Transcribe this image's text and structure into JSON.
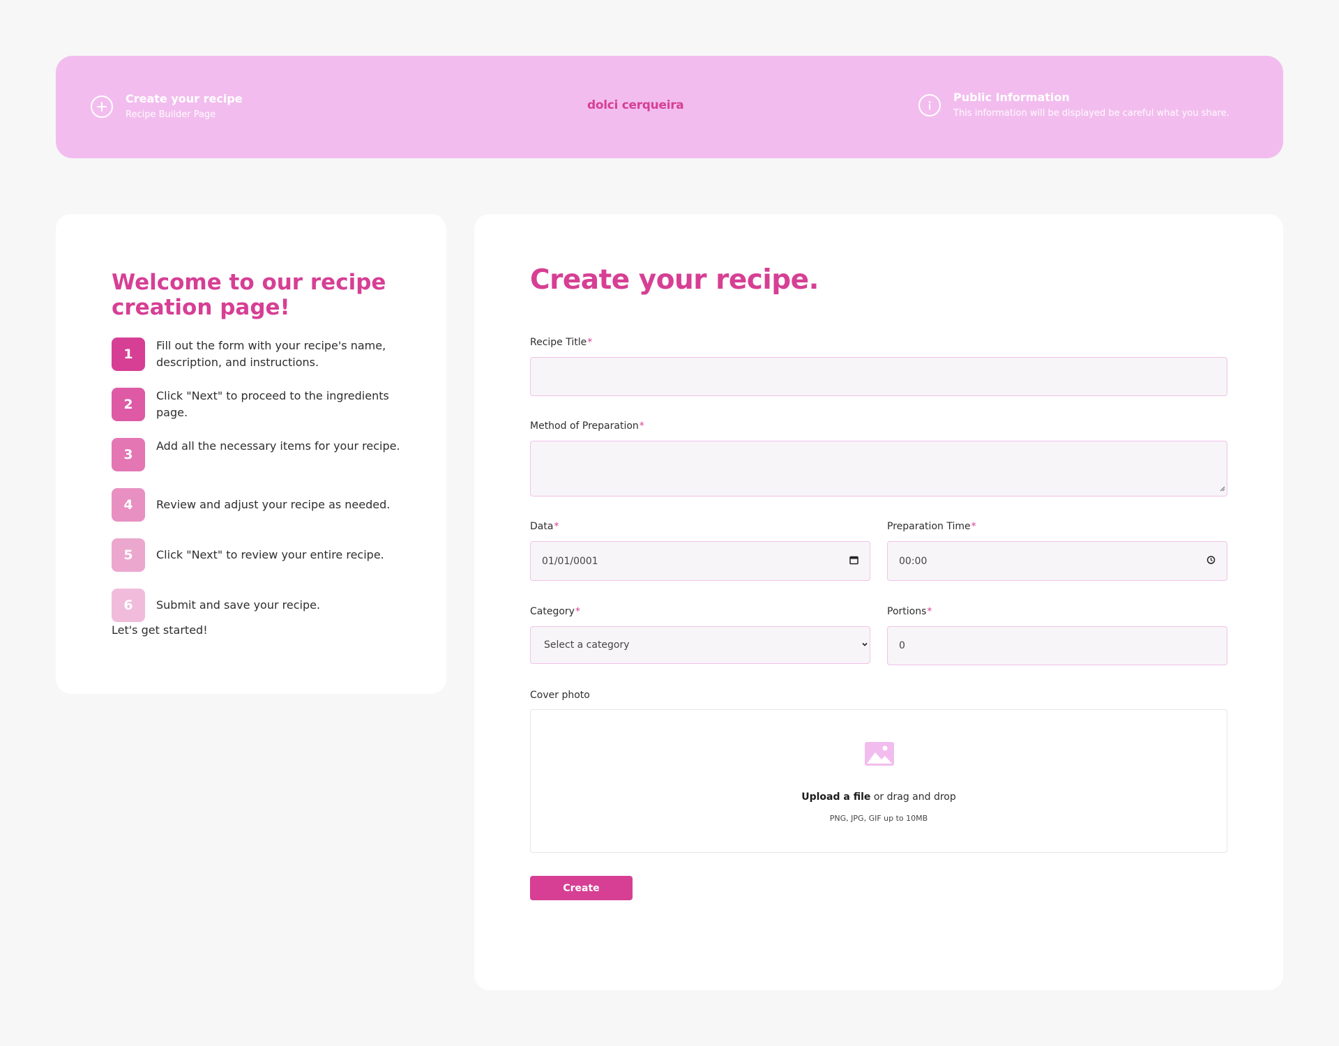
{
  "header": {
    "create_title": "Create your recipe",
    "create_subtitle": "Recipe Builder Page",
    "brand": "dolci cerqueira",
    "info_title": "Public Information",
    "info_subtitle": "This information will be displayed be careful what you share."
  },
  "welcome": {
    "title": "Welcome to our recipe creation page!",
    "steps": [
      {
        "number": "1",
        "text": "Fill out the form with your recipe's name, description, and instructions.",
        "color": "#d63f94"
      },
      {
        "number": "2",
        "text": "Click \"Next\" to proceed to the ingredients page.",
        "color": "#de5aa5"
      },
      {
        "number": "3",
        "text": "Add all the necessary items for your recipe.",
        "color": "#e376b3"
      },
      {
        "number": "4",
        "text": "Review and adjust your recipe as needed.",
        "color": "#e890c2"
      },
      {
        "number": "5",
        "text": "Click \"Next\" to review your entire recipe.",
        "color": "#eca7cf"
      },
      {
        "number": "6",
        "text": "Submit and save your recipe.",
        "color": "#f1bcdb"
      }
    ],
    "closing": "Let's get started!"
  },
  "form": {
    "title": "Create your recipe.",
    "recipe_title_label": "Recipe Title",
    "recipe_title_value": "",
    "method_label": "Method of Preparation",
    "method_value": "",
    "date_label": "Data",
    "date_value": "01/01/0001",
    "prep_time_label": "Preparation Time",
    "prep_time_value": "00:00",
    "category_label": "Category",
    "category_value": "Select a category",
    "portions_label": "Portions",
    "portions_value": "0",
    "required_mark": "*",
    "cover_label": "Cover photo",
    "upload_link": "Upload a file",
    "upload_text": " or drag and drop",
    "upload_hint": "PNG, JPG, GIF up to 10MB",
    "submit_label": "Create"
  },
  "icons": {
    "create": "plus-circle-icon",
    "info": "info-circle-icon",
    "calendar": "calendar-icon",
    "clock": "clock-icon",
    "dropdown": "chevron-down-icon",
    "image": "image-icon"
  },
  "colors": {
    "accent": "#d63f94",
    "banner": "#f2bdee",
    "background": "#f7f7f7"
  }
}
